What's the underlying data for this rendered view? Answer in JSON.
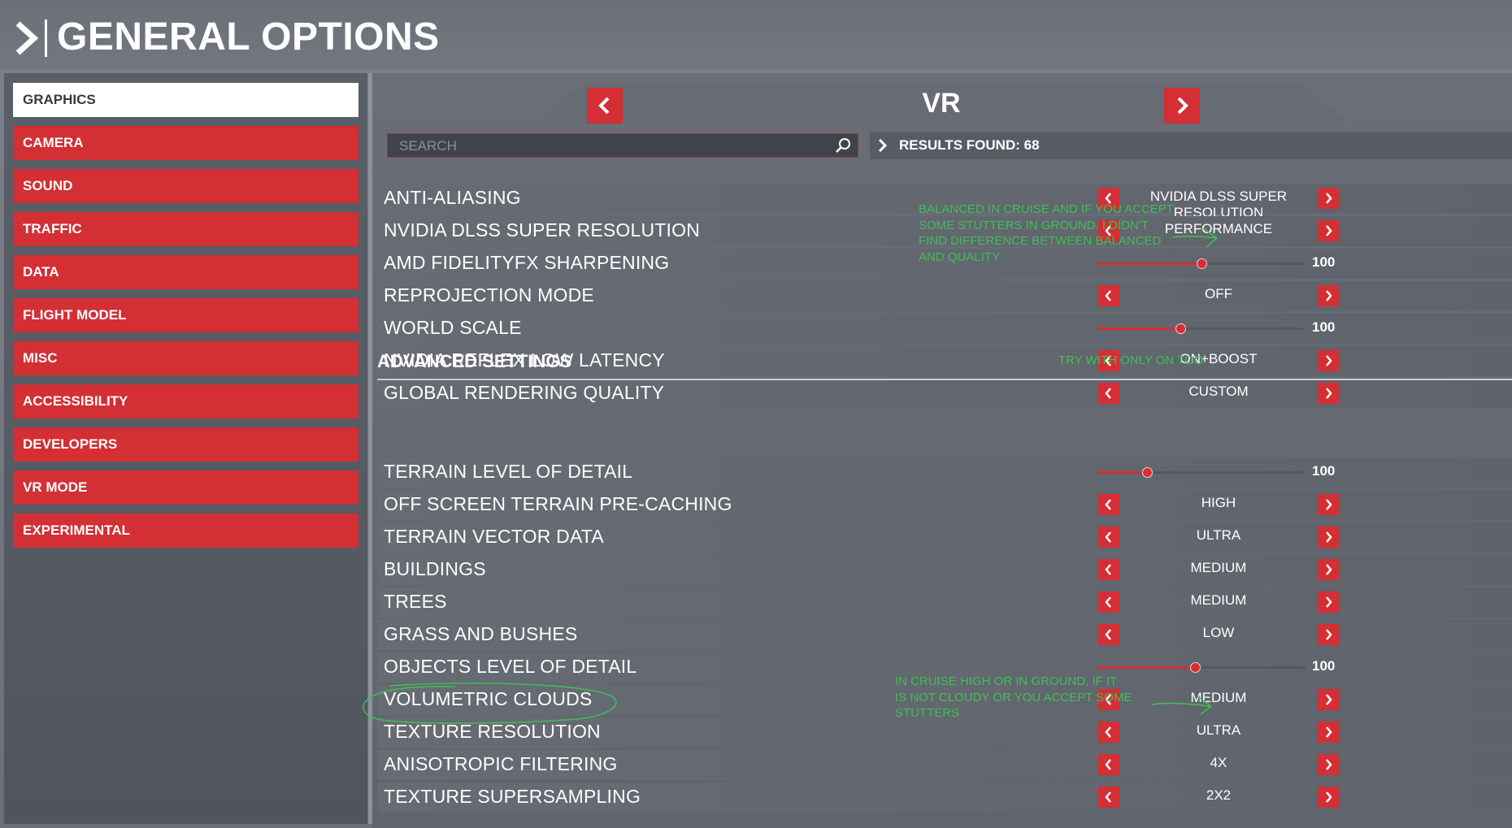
{
  "header": {
    "title": "GENERAL OPTIONS"
  },
  "sidebar": {
    "items": [
      {
        "label": "GRAPHICS"
      },
      {
        "label": "CAMERA"
      },
      {
        "label": "SOUND"
      },
      {
        "label": "TRAFFIC"
      },
      {
        "label": "DATA"
      },
      {
        "label": "FLIGHT MODEL"
      },
      {
        "label": "MISC"
      },
      {
        "label": "ACCESSIBILITY"
      },
      {
        "label": "DEVELOPERS"
      },
      {
        "label": "VR MODE"
      },
      {
        "label": "EXPERIMENTAL"
      }
    ]
  },
  "main": {
    "title": "VR",
    "search_placeholder": "SEARCH",
    "results": "RESULTS FOUND: 68",
    "section_title": "ADVANCED SETTINGS",
    "rows": [
      {
        "label": "ANTI-ALIASING",
        "type": "select",
        "value": "NVIDIA DLSS SUPER RESOLUTION"
      },
      {
        "label": "NVIDIA DLSS SUPER RESOLUTION",
        "type": "select",
        "value": "PERFORMANCE"
      },
      {
        "label": "AMD FIDELITYFX SHARPENING",
        "type": "slider",
        "value": "100",
        "level": 0.5
      },
      {
        "label": "REPROJECTION MODE",
        "type": "select",
        "value": "OFF"
      },
      {
        "label": "WORLD SCALE",
        "type": "slider",
        "value": "100",
        "level": 0.4
      },
      {
        "label": "NVIDIA REFLEX LOW LATENCY",
        "type": "select",
        "value": "ON+BOOST"
      },
      {
        "label": "GLOBAL RENDERING QUALITY",
        "type": "select",
        "value": "CUSTOM"
      },
      {
        "label": "TERRAIN LEVEL OF DETAIL",
        "type": "slider",
        "value": "100",
        "level": 0.24
      },
      {
        "label": "OFF SCREEN TERRAIN PRE-CACHING",
        "type": "select",
        "value": "HIGH"
      },
      {
        "label": "TERRAIN VECTOR DATA",
        "type": "select",
        "value": "ULTRA"
      },
      {
        "label": "BUILDINGS",
        "type": "select",
        "value": "MEDIUM"
      },
      {
        "label": "TREES",
        "type": "select",
        "value": "MEDIUM"
      },
      {
        "label": "GRASS AND BUSHES",
        "type": "select",
        "value": "LOW"
      },
      {
        "label": "OBJECTS LEVEL OF DETAIL",
        "type": "slider",
        "value": "100",
        "level": 0.47
      },
      {
        "label": "VOLUMETRIC CLOUDS",
        "type": "select",
        "value": "MEDIUM"
      },
      {
        "label": "TEXTURE RESOLUTION",
        "type": "select",
        "value": "ULTRA"
      },
      {
        "label": "ANISOTROPIC FILTERING",
        "type": "select",
        "value": "4X"
      },
      {
        "label": "TEXTURE SUPERSAMPLING",
        "type": "select",
        "value": "2X2"
      }
    ]
  },
  "annotations": {
    "dlss_note": [
      "BALANCED IN CRUISE AND IF YOU ACCEPT",
      "SOME STUTTERS IN GROUND. I DIDN'T",
      "FIND DIFFERENCE BETWEEN BALANCED",
      "AND QUALITY"
    ],
    "reflex_note": "TRY WITH ONLY ON TOO",
    "clouds_note": [
      "IN CRUISE HIGH OR IN GROUND, IF IT",
      "IS NOT CLOUDY OR YOU ACCEPT SOME",
      "STUTTERS"
    ]
  },
  "colors": {
    "accent": "#d32f35",
    "annotation": "#3fbf56"
  }
}
